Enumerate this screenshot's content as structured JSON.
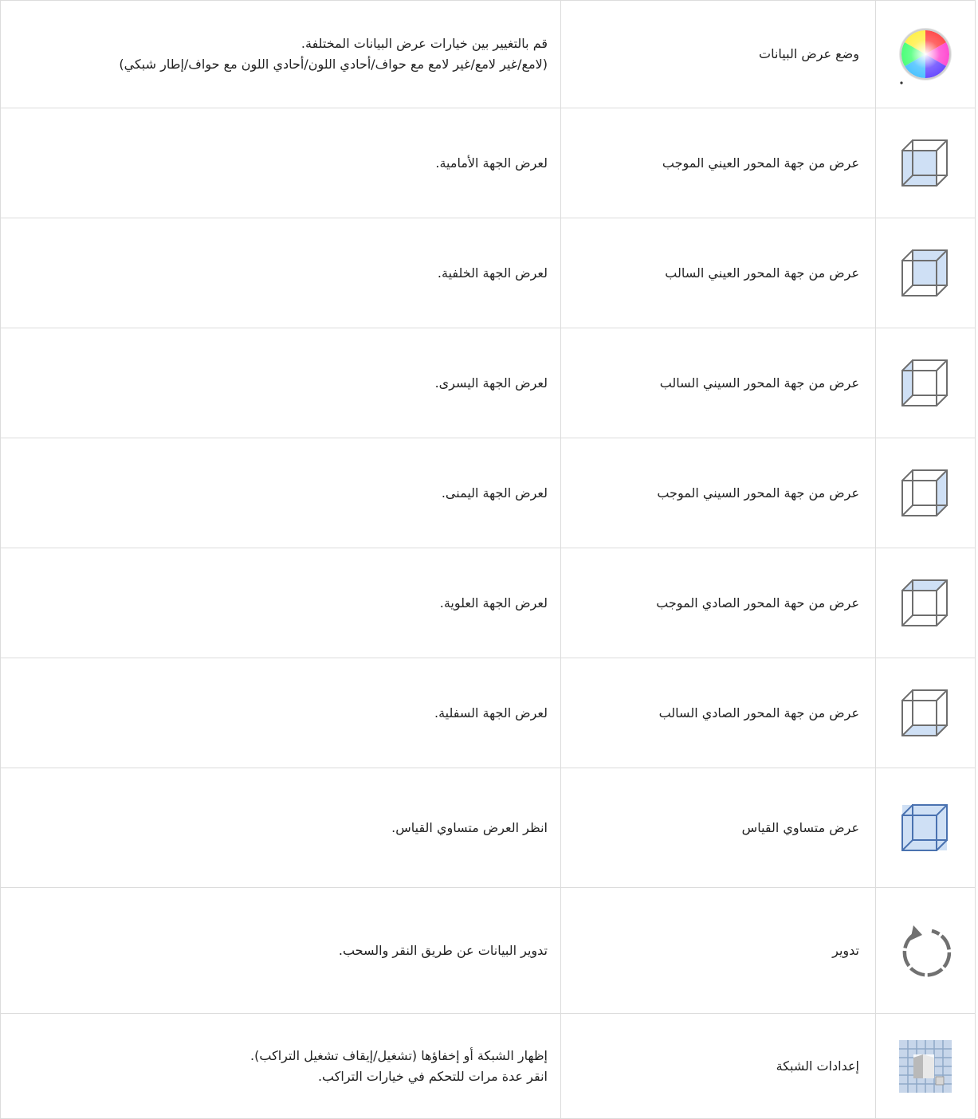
{
  "rows": [
    {
      "icon": "color-wheel-icon",
      "name": "وضع عرض البيانات",
      "desc": [
        "قم بالتغيير بين خيارات عرض البيانات المختلفة.",
        "(لامع/غير لامع/غير لامع مع حواف/أحادي اللون/أحادي اللون مع حواف/إطار شبكي)"
      ]
    },
    {
      "icon": "cube-front-icon",
      "name": "عرض من جهة المحور العيني الموجب",
      "desc": [
        "لعرض الجهة الأمامية."
      ]
    },
    {
      "icon": "cube-back-icon",
      "name": "عرض من جهة المحور العيني السالب",
      "desc": [
        "لعرض الجهة الخلفية."
      ]
    },
    {
      "icon": "cube-left-icon",
      "name": "عرض من جهة المحور السيني السالب",
      "desc": [
        "لعرض الجهة اليسرى."
      ]
    },
    {
      "icon": "cube-right-icon",
      "name": "عرض من جهة المحور السيني الموجب",
      "desc": [
        "لعرض الجهة اليمنى."
      ]
    },
    {
      "icon": "cube-top-icon",
      "name": "عرض من حهة المحور الصادي الموجب",
      "desc": [
        "لعرض الجهة العلوية."
      ]
    },
    {
      "icon": "cube-bottom-icon",
      "name": "عرض من جهة المحور الصادي السالب",
      "desc": [
        "لعرض الجهة السفلية."
      ]
    },
    {
      "icon": "cube-isometric-icon",
      "name": "عرض متساوي القياس",
      "desc": [
        "انظر العرض متساوي القياس."
      ]
    },
    {
      "icon": "rotate-icon",
      "name": "تدوير",
      "desc": [
        "تدوير البيانات عن طريق النقر والسحب."
      ]
    },
    {
      "icon": "grid-settings-icon",
      "name": "إعدادات الشبكة",
      "desc": [
        "إظهار الشبكة أو إخفاؤها (تشغيل/إيقاف تشغيل التراكب).",
        "انقر عدة مرات للتحكم في خيارات التراكب."
      ]
    }
  ],
  "colors": {
    "border": "#dcdcdc",
    "cube_line": "#6e6e6e",
    "cube_fill": "#cfe0f5",
    "rotate_arrow": "#707070"
  }
}
